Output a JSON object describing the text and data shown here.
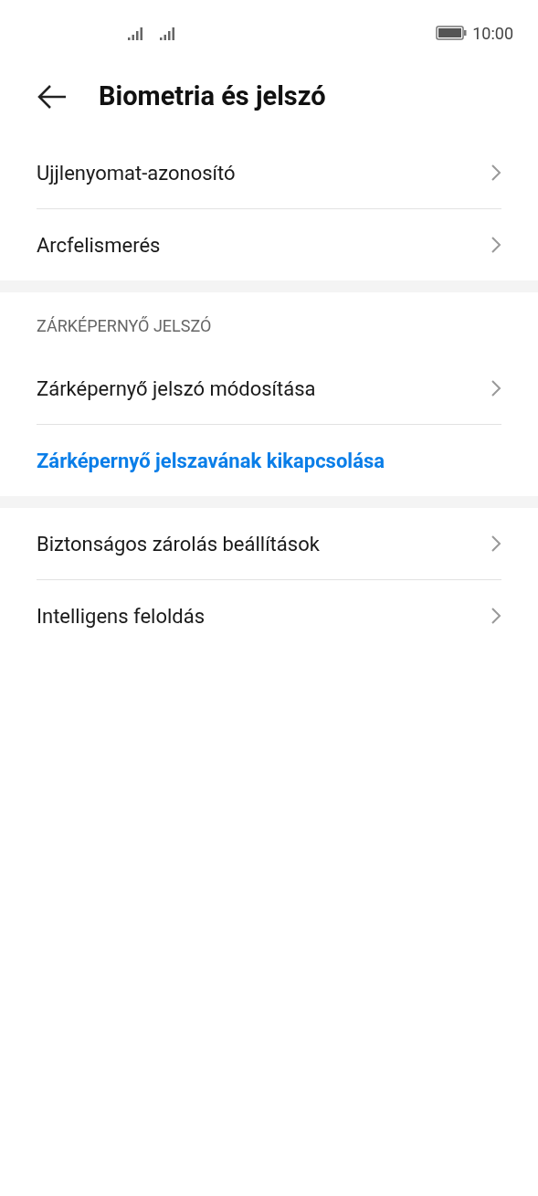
{
  "status_bar": {
    "time": "10:00"
  },
  "header": {
    "title": "Biometria és jelszó"
  },
  "sections": [
    {
      "items": [
        {
          "label": "Ujjlenyomat-azonosító",
          "kind": "nav"
        },
        {
          "label": "Arcfelismerés",
          "kind": "nav"
        }
      ]
    },
    {
      "heading": "ZÁRKÉPERNYŐ JELSZÓ",
      "items": [
        {
          "label": "Zárképernyő jelszó módosítása",
          "kind": "nav"
        },
        {
          "label": "Zárképernyő jelszavának kikapcsolása",
          "kind": "action"
        }
      ]
    },
    {
      "items": [
        {
          "label": "Biztonságos zárolás beállítások",
          "kind": "nav"
        },
        {
          "label": "Intelligens feloldás",
          "kind": "nav"
        }
      ]
    }
  ]
}
